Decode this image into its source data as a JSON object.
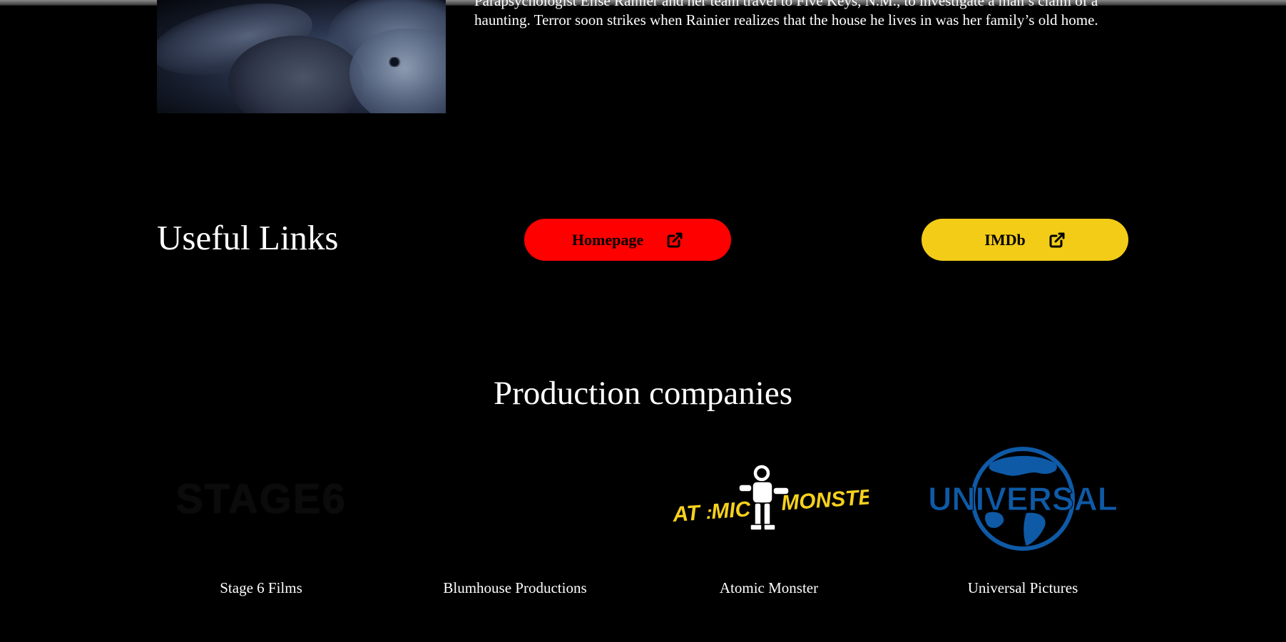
{
  "movie": {
    "synopsis_line1": "Parapsychologist Elise Rainier and her team travel to Five Keys, N.M., to investigate a man’s claim of a",
    "synopsis_line2": "haunting. Terror soon strikes when Rainier realizes that the house he lives in was her family’s old home."
  },
  "useful_links": {
    "title": "Useful Links",
    "homepage_label": "Homepage",
    "imdb_label": "IMDb",
    "homepage_color": "#ff0000",
    "imdb_color": "#f2cc17",
    "icon": "external-link-icon"
  },
  "production": {
    "title": "Production companies",
    "companies": [
      {
        "name": "Stage 6 Films",
        "logo_text": "STAGE6"
      },
      {
        "name": "Blumhouse Productions",
        "logo_text": ""
      },
      {
        "name": "Atomic Monster",
        "logo_text": "AT:MIC MONSTER"
      },
      {
        "name": "Universal Pictures",
        "logo_text": "UNIVERSAL"
      }
    ]
  },
  "colors": {
    "background": "#000000",
    "universal_blue": "#0e5aa7",
    "atomic_yellow": "#f6d11d"
  }
}
